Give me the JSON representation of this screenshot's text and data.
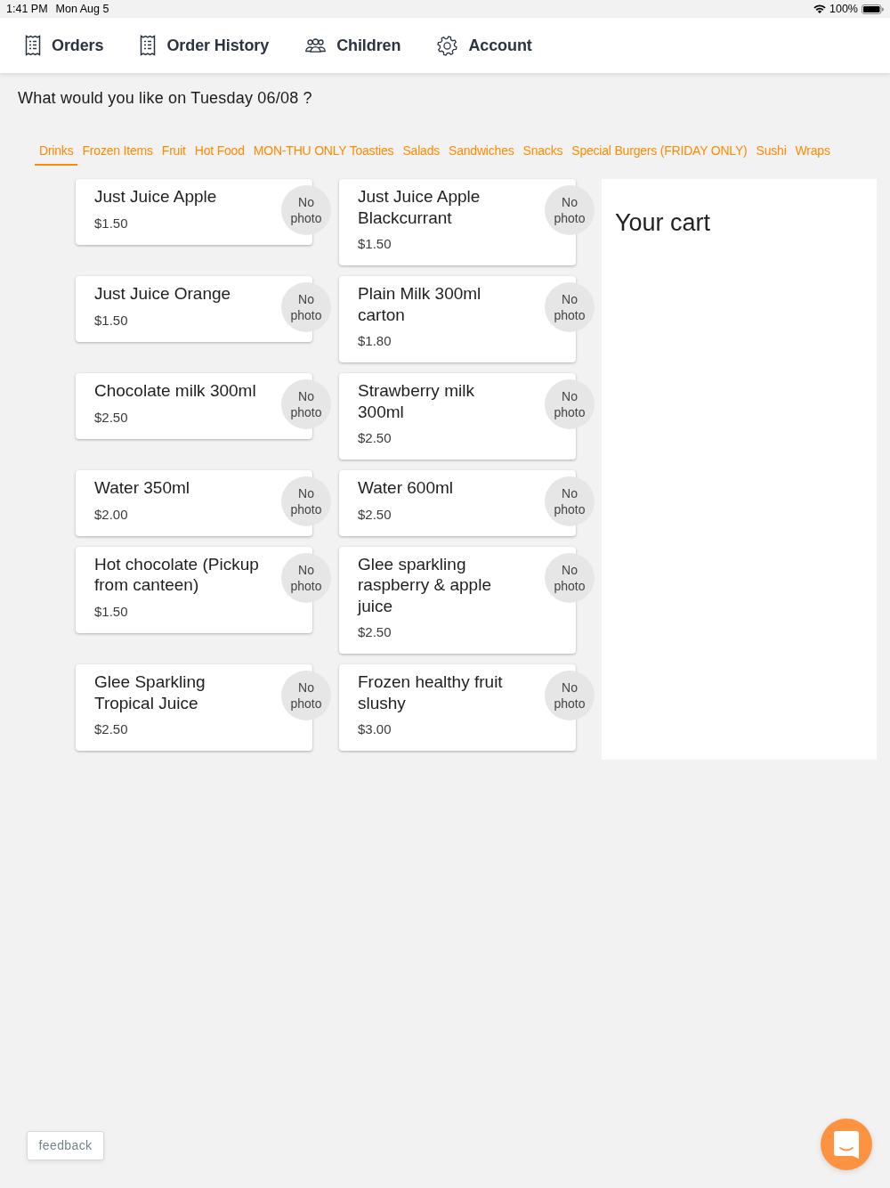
{
  "status_bar": {
    "time": "1:41 PM",
    "date": "Mon Aug 5",
    "battery": "100%"
  },
  "nav_items": [
    {
      "label": "Orders"
    },
    {
      "label": "Order History"
    },
    {
      "label": "Children"
    },
    {
      "label": "Account"
    }
  ],
  "question": "What would you like on Tuesday 06/08 ?",
  "categories": [
    {
      "label": "Drinks",
      "selected": true
    },
    {
      "label": "Frozen Items",
      "selected": false
    },
    {
      "label": "Fruit",
      "selected": false
    },
    {
      "label": "Hot Food",
      "selected": false
    },
    {
      "label": "MON-THU ONLY Toasties",
      "selected": false
    },
    {
      "label": "Salads",
      "selected": false
    },
    {
      "label": "Sandwiches",
      "selected": false
    },
    {
      "label": "Snacks",
      "selected": false
    },
    {
      "label": "Special Burgers (FRIDAY ONLY)",
      "selected": false
    },
    {
      "label": "Sushi",
      "selected": false
    },
    {
      "label": "Wraps",
      "selected": false
    }
  ],
  "products": [
    {
      "name": "Just Juice Apple",
      "price": "$1.50",
      "photo": "No photo"
    },
    {
      "name": "Just Juice Apple Blackcurrant",
      "price": "$1.50",
      "photo": "No photo"
    },
    {
      "name": "Just Juice Orange",
      "price": "$1.50",
      "photo": "No photo"
    },
    {
      "name": "Plain Milk 300ml carton",
      "price": "$1.80",
      "photo": "No photo"
    },
    {
      "name": "Chocolate milk 300ml",
      "price": "$2.50",
      "photo": "No photo"
    },
    {
      "name": "Strawberry milk 300ml",
      "price": "$2.50",
      "photo": "No photo"
    },
    {
      "name": "Water 350ml",
      "price": "$2.00",
      "photo": "No photo"
    },
    {
      "name": "Water 600ml",
      "price": "$2.50",
      "photo": "No photo"
    },
    {
      "name": "Hot chocolate (Pickup from canteen)",
      "price": "$1.50",
      "photo": "No photo"
    },
    {
      "name": "Glee sparkling raspberry & apple juice",
      "price": "$2.50",
      "photo": "No photo"
    },
    {
      "name": "Glee Sparkling Tropical Juice",
      "price": "$2.50",
      "photo": "No photo"
    },
    {
      "name": "Frozen healthy fruit slushy",
      "price": "$3.00",
      "photo": "No photo"
    }
  ],
  "cart": {
    "title": "Your cart"
  },
  "feedback_button": {
    "label": "feedback"
  }
}
